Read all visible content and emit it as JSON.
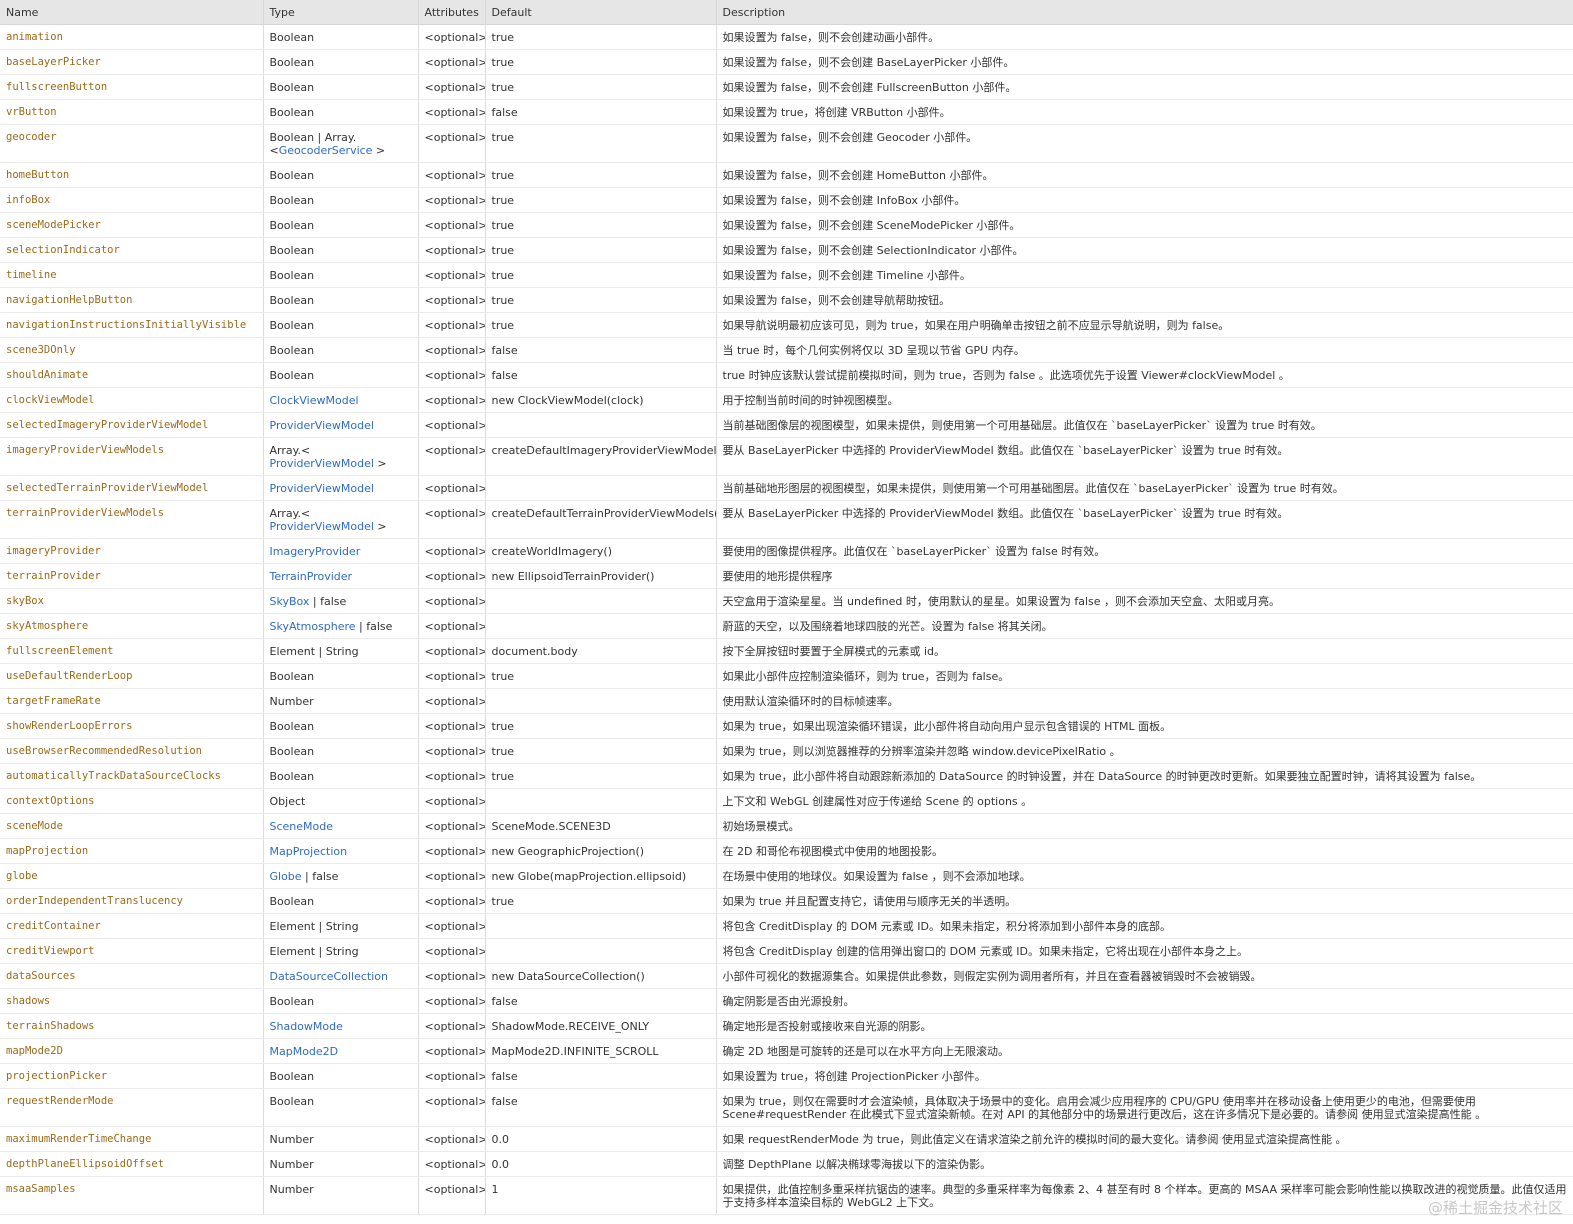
{
  "headers": {
    "name": "Name",
    "type": "Type",
    "attributes": "Attributes",
    "default": "Default",
    "description": "Description"
  },
  "rows": [
    {
      "name": "animation",
      "type": "Boolean",
      "attr": "<optional>",
      "default": "true",
      "desc": "如果设置为 false，则不会创建动画小部件。"
    },
    {
      "name": "baseLayerPicker",
      "type": "Boolean",
      "attr": "<optional>",
      "default": "true",
      "desc": "如果设置为 false，则不会创建 BaseLayerPicker 小部件。"
    },
    {
      "name": "fullscreenButton",
      "type": "Boolean",
      "attr": "<optional>",
      "default": "true",
      "desc": "如果设置为 false，则不会创建 FullscreenButton 小部件。"
    },
    {
      "name": "vrButton",
      "type": "Boolean",
      "attr": "<optional>",
      "default": "false",
      "desc": "如果设置为 true，将创建 VRButton 小部件。"
    },
    {
      "name": "geocoder",
      "type": "Boolean | Array.<",
      "type_link": "GeocoderService",
      "type_suffix": " >",
      "attr": "<optional>",
      "default": "true",
      "desc": "如果设置为 false，则不会创建 Geocoder 小部件。",
      "tall": true
    },
    {
      "name": "homeButton",
      "type": "Boolean",
      "attr": "<optional>",
      "default": "true",
      "desc": "如果设置为 false，则不会创建 HomeButton 小部件。"
    },
    {
      "name": "infoBox",
      "type": "Boolean",
      "attr": "<optional>",
      "default": "true",
      "desc": "如果设置为 false，则不会创建 InfoBox 小部件。"
    },
    {
      "name": "sceneModePicker",
      "type": "Boolean",
      "attr": "<optional>",
      "default": "true",
      "desc": "如果设置为 false，则不会创建 SceneModePicker 小部件。"
    },
    {
      "name": "selectionIndicator",
      "type": "Boolean",
      "attr": "<optional>",
      "default": "true",
      "desc": "如果设置为 false，则不会创建 SelectionIndicator 小部件。"
    },
    {
      "name": "timeline",
      "type": "Boolean",
      "attr": "<optional>",
      "default": "true",
      "desc": "如果设置为 false，则不会创建 Timeline 小部件。"
    },
    {
      "name": "navigationHelpButton",
      "type": "Boolean",
      "attr": "<optional>",
      "default": "true",
      "desc": "如果设置为 false，则不会创建导航帮助按钮。"
    },
    {
      "name": "navigationInstructionsInitiallyVisible",
      "type": "Boolean",
      "attr": "<optional>",
      "default": "true",
      "desc": "如果导航说明最初应该可见，则为 true，如果在用户明确单击按钮之前不应显示导航说明，则为 false。"
    },
    {
      "name": "scene3DOnly",
      "type": "Boolean",
      "attr": "<optional>",
      "default": "false",
      "desc": "当 true 时，每个几何实例将仅以 3D 呈现以节省 GPU 内存。"
    },
    {
      "name": "shouldAnimate",
      "type": "Boolean",
      "attr": "<optional>",
      "default": "false",
      "desc": "true 时钟应该默认尝试提前模拟时间，则为 true，否则为 false 。此选项优先于设置 Viewer#clockViewModel 。"
    },
    {
      "name": "clockViewModel",
      "type": "",
      "type_link": "ClockViewModel",
      "attr": "<optional>",
      "default": "new ClockViewModel(clock)",
      "desc": "用于控制当前时间的时钟视图模型。"
    },
    {
      "name": "selectedImageryProviderViewModel",
      "type": "",
      "type_link": "ProviderViewModel",
      "attr": "<optional>",
      "default": "",
      "desc": "当前基础图像层的视图模型，如果未提供，则使用第一个可用基础层。此值仅在 `baseLayerPicker` 设置为 true 时有效。"
    },
    {
      "name": "imageryProviderViewModels",
      "type": "Array.< ",
      "type_link": "ProviderViewModel",
      "type_suffix": " >",
      "attr": "<optional>",
      "default": "createDefaultImageryProviderViewModels()",
      "desc": "要从 BaseLayerPicker 中选择的 ProviderViewModel 数组。此值仅在 `baseLayerPicker` 设置为 true 时有效。",
      "tall": true
    },
    {
      "name": "selectedTerrainProviderViewModel",
      "type": "",
      "type_link": "ProviderViewModel",
      "attr": "<optional>",
      "default": "",
      "desc": "当前基础地形图层的视图模型，如果未提供，则使用第一个可用基础图层。此值仅在 `baseLayerPicker` 设置为 true 时有效。"
    },
    {
      "name": "terrainProviderViewModels",
      "type": "Array.< ",
      "type_link": "ProviderViewModel",
      "type_suffix": " >",
      "attr": "<optional>",
      "default": "createDefaultTerrainProviderViewModels()",
      "desc": "要从 BaseLayerPicker 中选择的 ProviderViewModel 数组。此值仅在 `baseLayerPicker` 设置为 true 时有效。",
      "tall": true
    },
    {
      "name": "imageryProvider",
      "type": "",
      "type_link": "ImageryProvider",
      "attr": "<optional>",
      "default": "createWorldImagery()",
      "desc": "要使用的图像提供程序。此值仅在 `baseLayerPicker` 设置为 false 时有效。"
    },
    {
      "name": "terrainProvider",
      "type": "",
      "type_link": "TerrainProvider",
      "attr": "<optional>",
      "default": "new EllipsoidTerrainProvider()",
      "desc": "要使用的地形提供程序"
    },
    {
      "name": "skyBox",
      "type": "",
      "type_link": "SkyBox",
      "type_suffix": " | false",
      "attr": "<optional>",
      "default": "",
      "desc": "天空盒用于渲染星星。当 undefined 时，使用默认的星星。如果设置为 false ，则不会添加天空盒、太阳或月亮。"
    },
    {
      "name": "skyAtmosphere",
      "type": "",
      "type_link": "SkyAtmosphere",
      "type_suffix": " | false",
      "attr": "<optional>",
      "default": "",
      "desc": "蔚蓝的天空，以及围绕着地球四肢的光芒。设置为 false 将其关闭。"
    },
    {
      "name": "fullscreenElement",
      "type": "Element | String",
      "attr": "<optional>",
      "default": "document.body",
      "desc": "按下全屏按钮时要置于全屏模式的元素或 id。"
    },
    {
      "name": "useDefaultRenderLoop",
      "type": "Boolean",
      "attr": "<optional>",
      "default": "true",
      "desc": "如果此小部件应控制渲染循环，则为 true，否则为 false。"
    },
    {
      "name": "targetFrameRate",
      "type": "Number",
      "attr": "<optional>",
      "default": "",
      "desc": "使用默认渲染循环时的目标帧速率。"
    },
    {
      "name": "showRenderLoopErrors",
      "type": "Boolean",
      "attr": "<optional>",
      "default": "true",
      "desc": "如果为 true，如果出现渲染循环错误，此小部件将自动向用户显示包含错误的 HTML 面板。"
    },
    {
      "name": "useBrowserRecommendedResolution",
      "type": "Boolean",
      "attr": "<optional>",
      "default": "true",
      "desc": "如果为 true，则以浏览器推荐的分辨率渲染并忽略 window.devicePixelRatio 。"
    },
    {
      "name": "automaticallyTrackDataSourceClocks",
      "type": "Boolean",
      "attr": "<optional>",
      "default": "true",
      "desc": "如果为 true，此小部件将自动跟踪新添加的 DataSource 的时钟设置，并在 DataSource 的时钟更改时更新。如果要独立配置时钟，请将其设置为 false。"
    },
    {
      "name": "contextOptions",
      "type": "Object",
      "attr": "<optional>",
      "default": "",
      "desc": "上下文和 WebGL 创建属性对应于传递给 Scene 的 options 。"
    },
    {
      "name": "sceneMode",
      "type": "",
      "type_link": "SceneMode",
      "attr": "<optional>",
      "default": "SceneMode.SCENE3D",
      "desc": "初始场景模式。"
    },
    {
      "name": "mapProjection",
      "type": "",
      "type_link": "MapProjection",
      "attr": "<optional>",
      "default": "new GeographicProjection()",
      "desc": "在 2D 和哥伦布视图模式中使用的地图投影。"
    },
    {
      "name": "globe",
      "type": "",
      "type_link": "Globe",
      "type_suffix": " | false",
      "attr": "<optional>",
      "default": "new Globe(mapProjection.ellipsoid)",
      "desc": "在场景中使用的地球仪。如果设置为 false ，则不会添加地球。"
    },
    {
      "name": "orderIndependentTranslucency",
      "type": "Boolean",
      "attr": "<optional>",
      "default": "true",
      "desc": "如果为 true 并且配置支持它，请使用与顺序无关的半透明。"
    },
    {
      "name": "creditContainer",
      "type": "Element | String",
      "attr": "<optional>",
      "default": "",
      "desc": "将包含 CreditDisplay 的 DOM 元素或 ID。如果未指定，积分将添加到小部件本身的底部。"
    },
    {
      "name": "creditViewport",
      "type": "Element | String",
      "attr": "<optional>",
      "default": "",
      "desc": "将包含 CreditDisplay 创建的信用弹出窗口的 DOM 元素或 ID。如果未指定，它将出现在小部件本身之上。"
    },
    {
      "name": "dataSources",
      "type": "",
      "type_link": "DataSourceCollection",
      "attr": "<optional>",
      "default": "new DataSourceCollection()",
      "desc": "小部件可视化的数据源集合。如果提供此参数，则假定实例为调用者所有，并且在查看器被销毁时不会被销毁。"
    },
    {
      "name": "shadows",
      "type": "Boolean",
      "attr": "<optional>",
      "default": "false",
      "desc": "确定阴影是否由光源投射。"
    },
    {
      "name": "terrainShadows",
      "type": "",
      "type_link": "ShadowMode",
      "attr": "<optional>",
      "default": "ShadowMode.RECEIVE_ONLY",
      "desc": "确定地形是否投射或接收来自光源的阴影。"
    },
    {
      "name": "mapMode2D",
      "type": "",
      "type_link": "MapMode2D",
      "attr": "<optional>",
      "default": "MapMode2D.INFINITE_SCROLL",
      "desc": "确定 2D 地图是可旋转的还是可以在水平方向上无限滚动。"
    },
    {
      "name": "projectionPicker",
      "type": "Boolean",
      "attr": "<optional>",
      "default": "false",
      "desc": "如果设置为 true，将创建 ProjectionPicker 小部件。"
    },
    {
      "name": "requestRenderMode",
      "type": "Boolean",
      "attr": "<optional>",
      "default": "false",
      "desc": "如果为 true，则仅在需要时才会渲染帧，具体取决于场景中的变化。启用会减少应用程序的 CPU/GPU 使用率并在移动设备上使用更少的电池，但需要使用 Scene#requestRender 在此模式下显式渲染新帧。在对 API 的其他部分中的场景进行更改后，这在许多情况下是必要的。请参阅 使用显式渲染提高性能 。",
      "tall": true
    },
    {
      "name": "maximumRenderTimeChange",
      "type": "Number",
      "attr": "<optional>",
      "default": "0.0",
      "desc": "如果 requestRenderMode 为 true，则此值定义在请求渲染之前允许的模拟时间的最大变化。请参阅 使用显式渲染提高性能 。"
    },
    {
      "name": "depthPlaneEllipsoidOffset",
      "type": "Number",
      "attr": "<optional>",
      "default": "0.0",
      "desc": "调整 DepthPlane 以解决椭球零海拔以下的渲染伪影。"
    },
    {
      "name": "msaaSamples",
      "type": "Number",
      "attr": "<optional>",
      "default": "1",
      "desc": "如果提供，此值控制多重采样抗锯齿的速率。典型的多重采样率为每像素 2、4 甚至有时 8 个样本。更高的 MSAA 采样率可能会影响性能以换取改进的视觉质量。此值仅适用于支持多样本渲染目标的 WebGL2 上下文。",
      "tall": true
    }
  ],
  "watermark": "@稀土掘金技术社区"
}
